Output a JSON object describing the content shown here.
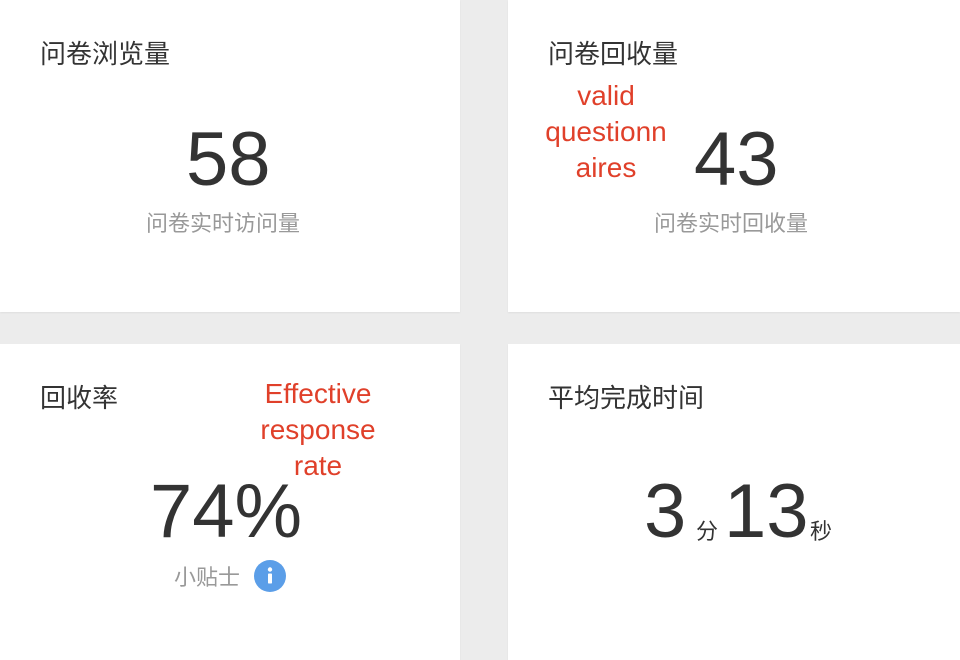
{
  "cards": {
    "views": {
      "title": "问卷浏览量",
      "value": "58",
      "sub_label": "问卷实时访问量"
    },
    "collected": {
      "title": "问卷回收量",
      "value": "43",
      "sub_label": "问卷实时回收量",
      "annotation": [
        "valid",
        "questionn",
        "aires"
      ]
    },
    "rate": {
      "title": "回收率",
      "value": "74%",
      "sub_label": "小贴士",
      "annotation": [
        "Effective",
        "response",
        "rate"
      ]
    },
    "avg_time": {
      "title": "平均完成时间",
      "minutes": "3",
      "minutes_unit": "分",
      "seconds": "13",
      "seconds_unit": "秒"
    }
  },
  "colors": {
    "background": "#ececec",
    "card": "#ffffff",
    "text": "#333333",
    "muted": "#999999",
    "annotation": "#e0402a",
    "info_icon": "#5b9ee8"
  },
  "icons": {
    "tip": "info-icon"
  }
}
